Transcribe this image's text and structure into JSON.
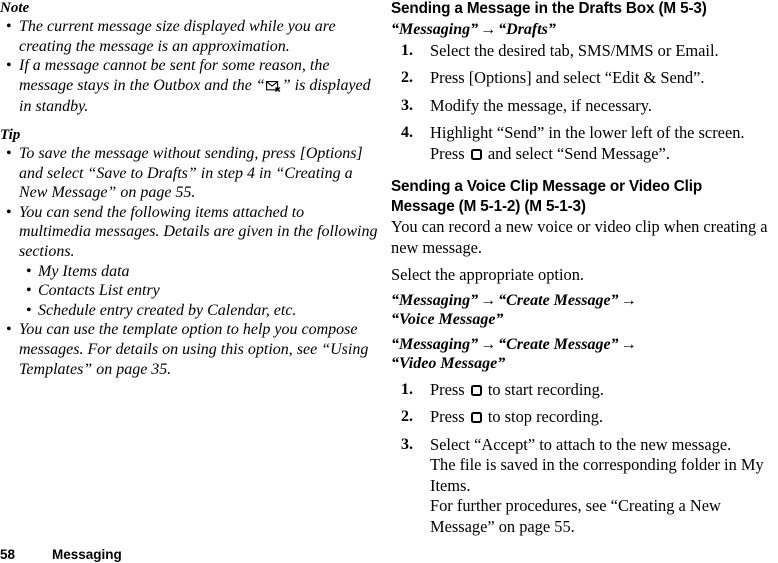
{
  "document": {
    "type": "mobile-phone-user-guide-page",
    "page_number": "58",
    "section_name": "Messaging"
  },
  "left_column": {
    "note": {
      "heading": "Note",
      "bullets": [
        {
          "parts": [
            {
              "text": "The current message size displayed while you are creating the message is an approximation."
            }
          ]
        },
        {
          "parts": [
            {
              "text": "If a message cannot be sent for some reason, the message stays in the Outbox and the “"
            },
            {
              "icon": "envelope-error-icon"
            },
            {
              "text": "” is displayed in standby."
            }
          ]
        }
      ]
    },
    "tip": {
      "heading": "Tip",
      "bullets": [
        {
          "text": "To save the message without sending, press [Options] and select “Save to Drafts” in step 4 in “Creating a New Message” on page 55."
        },
        {
          "text": "You can send the following items attached to multimedia messages. Details are given in the following sections.",
          "sub_bullets": [
            "My Items data",
            "Contacts List entry",
            "Schedule entry created by Calendar, etc."
          ]
        },
        {
          "text": "You can use the template option to help you compose messages. For details on using this option, see “Using Templates” on page 35."
        }
      ]
    }
  },
  "right_column": {
    "section_drafts": {
      "heading": "Sending a Message in the Drafts Box (M 5-3)",
      "nav_path": {
        "first": "“Messaging”",
        "arrow": "→",
        "second": "“Drafts”"
      },
      "steps": [
        {
          "num": "1.",
          "lines": [
            {
              "text": "Select the desired tab, SMS/MMS or Email."
            }
          ]
        },
        {
          "num": "2.",
          "lines": [
            {
              "text": "Press [Options] and select “Edit & Send”."
            }
          ]
        },
        {
          "num": "3.",
          "lines": [
            {
              "text": "Modify the message, if necessary."
            }
          ]
        },
        {
          "num": "4.",
          "lines": [
            {
              "text": "Highlight “Send” in the lower left of the screen."
            },
            {
              "parts": [
                {
                  "text": "Press "
                },
                {
                  "icon": "center-key-icon"
                },
                {
                  "text": " and select “Send Message”."
                }
              ]
            }
          ]
        }
      ]
    },
    "section_voice_video": {
      "heading_line1": "Sending a Voice Clip Message or Video Clip",
      "heading_line2": "Message (M 5-1-2) (M 5-1-3)",
      "intro": "You can record a new voice or video clip when creating a new message.",
      "select_option": "Select the appropriate option.",
      "nav_paths": [
        {
          "line1_first": "“Messaging”",
          "arrow1": "→",
          "line1_second": "“Create Message”",
          "arrow2": "→",
          "line2": "“Voice Message”"
        },
        {
          "line1_first": "“Messaging”",
          "arrow1": "→",
          "line1_second": "“Create Message”",
          "arrow2": "→",
          "line2": "“Video Message”"
        }
      ],
      "steps": [
        {
          "num": "1.",
          "lines": [
            {
              "parts": [
                {
                  "text": "Press "
                },
                {
                  "icon": "center-key-icon"
                },
                {
                  "text": " to start recording."
                }
              ]
            }
          ]
        },
        {
          "num": "2.",
          "lines": [
            {
              "parts": [
                {
                  "text": "Press "
                },
                {
                  "icon": "center-key-icon"
                },
                {
                  "text": " to stop recording."
                }
              ]
            }
          ]
        },
        {
          "num": "3.",
          "lines": [
            {
              "text": "Select “Accept” to attach to the new message."
            },
            {
              "text": "The file is saved in the corresponding folder in My Items."
            },
            {
              "text": "For further procedures, see “Creating a New Message” on page 55."
            }
          ]
        }
      ]
    }
  },
  "bullet_glyph": "•"
}
